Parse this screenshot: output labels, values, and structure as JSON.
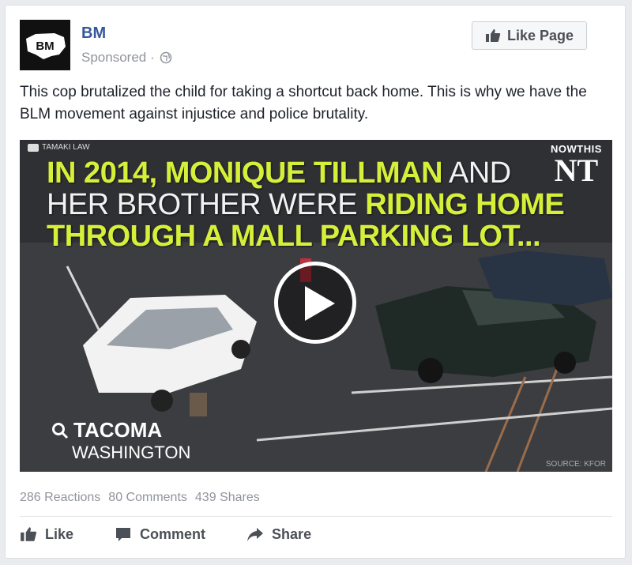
{
  "post": {
    "page_name": "BM",
    "avatar_text": "BM",
    "sponsored": "Sponsored ·",
    "like_page_label": "Like Page",
    "text": "This cop brutalized the child for taking a shortcut back home. This is why we have the BLM movement against injustice and police brutality."
  },
  "video": {
    "channel": "TAMAKI LAW",
    "brand_top": "NOWTHIS",
    "brand_logo": "NT",
    "headline": {
      "l1_a": "IN 2014, MONIQUE TILLMAN",
      "l1_b": " AND",
      "l2_a": "HER BROTHER WERE ",
      "l2_b": "RIDING HOME",
      "l3": "THROUGH A MALL PARKING LOT..."
    },
    "location_city": "TACOMA",
    "location_state": "WASHINGTON",
    "source": "SOURCE: KFOR"
  },
  "stats": {
    "reactions": "286 Reactions",
    "comments": "80 Comments",
    "shares": "439 Shares"
  },
  "actions": {
    "like": "Like",
    "comment": "Comment",
    "share": "Share"
  },
  "colors": {
    "link_blue": "#365899",
    "headline_yellow": "#d6f03a"
  }
}
